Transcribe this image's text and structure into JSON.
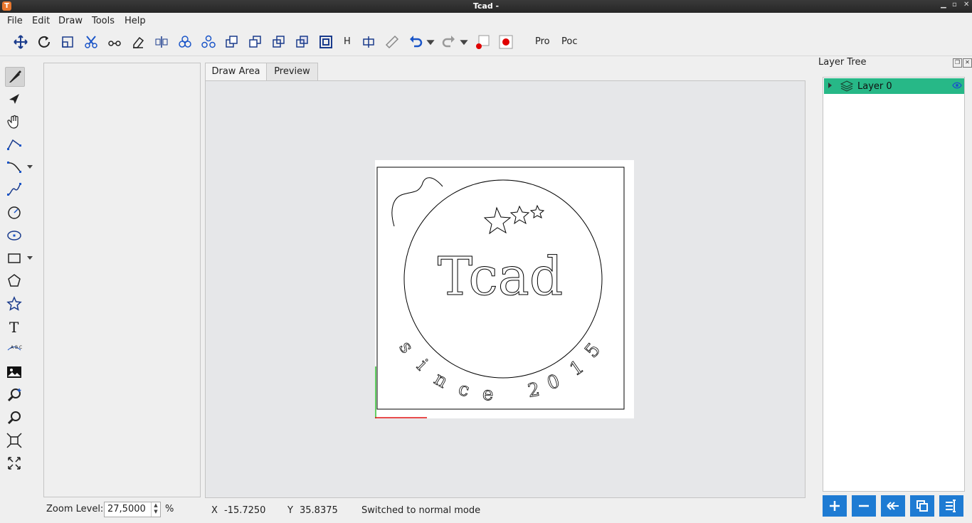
{
  "window": {
    "title": "Tcad -",
    "logo": "T"
  },
  "menu": [
    "File",
    "Edit",
    "Draw",
    "Tools",
    "Help"
  ],
  "toolbar": {
    "icons": [
      "move-icon",
      "rotate-icon",
      "scale-icon",
      "trim-icon",
      "break-icon",
      "erase-icon",
      "mirror-icon",
      "group-icon",
      "ungroup-icon",
      "bring-front-icon",
      "send-back-icon",
      "raise-icon",
      "lower-icon",
      "offset-icon"
    ],
    "h_label": "H",
    "pro_label": "Pro",
    "poc_label": "Poc"
  },
  "tabs": [
    "Draw Area",
    "Preview"
  ],
  "drawing": {
    "title_text": "Tcad",
    "arc_text": [
      "s",
      "i",
      "n",
      "c",
      "e",
      "2",
      "0",
      "1",
      "5"
    ]
  },
  "layer_tree": {
    "title": "Layer Tree",
    "layers": [
      {
        "name": "Layer 0"
      }
    ]
  },
  "status": {
    "zoom_label": "Zoom Level:",
    "zoom_value": "27,5000",
    "zoom_unit": "%",
    "x_label": "X",
    "x_value": "-15.7250",
    "y_label": "Y",
    "y_value": "35.8375",
    "message": "Switched to normal mode"
  },
  "colors": {
    "accent": "#1e7bd3",
    "layer_selected": "#27b887",
    "record": "#e00000"
  }
}
